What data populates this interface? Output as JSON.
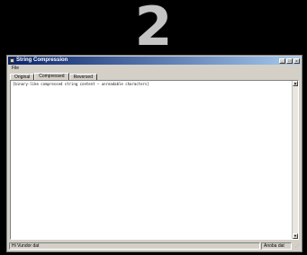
{
  "banner": {
    "number": "2"
  },
  "window": {
    "title": "String Compression",
    "app_icon": "app-window-icon",
    "controls": {
      "minimize": "_",
      "maximize": "□",
      "close": "x"
    }
  },
  "menubar": {
    "items": [
      {
        "label": "File"
      }
    ]
  },
  "tabs": [
    {
      "label": "Original",
      "active": false
    },
    {
      "label": "Compressed",
      "active": true
    },
    {
      "label": "Reversed",
      "active": false
    }
  ],
  "content": {
    "text": "[binary-like compressed string content — unreadable characters]"
  },
  "scrollbar": {
    "up_icon": "▲",
    "down_icon": "▼"
  },
  "statusbar": {
    "left": "Hi Vundor dat",
    "right": "Anoba dat",
    "grip": "⋰"
  },
  "colors": {
    "background": "#000000",
    "banner": "#c4c4c4",
    "window_face": "#d4d0c8",
    "titlebar_start": "#0a246a",
    "titlebar_end": "#a6caf0"
  }
}
